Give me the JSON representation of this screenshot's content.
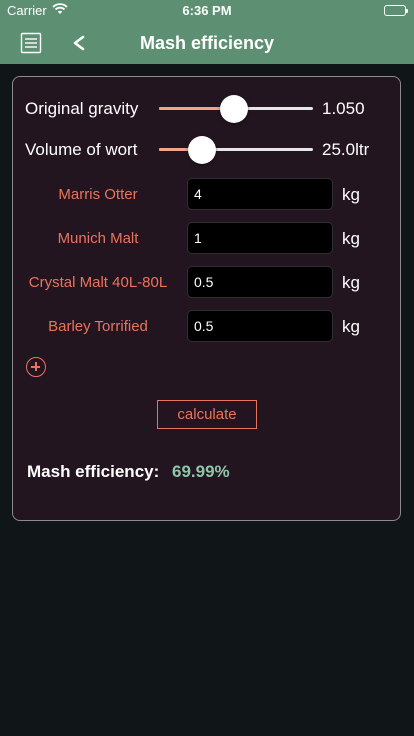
{
  "status_bar": {
    "carrier": "Carrier",
    "time": "6:36 PM",
    "icons": [
      "wifi-icon",
      "battery-icon"
    ]
  },
  "nav": {
    "title": "Mash efficiency",
    "menu_icon": "menu-icon",
    "back_icon": "chevron-left-icon"
  },
  "sliders": [
    {
      "label": "Original gravity",
      "value_text": "1.050",
      "fraction": 0.49
    },
    {
      "label": "Volume of wort",
      "value_text": "25.0ltr",
      "fraction": 0.28
    }
  ],
  "grains": [
    {
      "name": "Marris Otter",
      "amount": "4",
      "unit": "kg"
    },
    {
      "name": "Munich Malt",
      "amount": "1",
      "unit": "kg"
    },
    {
      "name": "Crystal Malt 40L-80L",
      "amount": "0.5",
      "unit": "kg"
    },
    {
      "name": "Barley Torrified",
      "amount": "0.5",
      "unit": "kg"
    }
  ],
  "add_icon": "plus-circle-icon",
  "calculate_label": "calculate",
  "result": {
    "label": "Mash efficiency:",
    "value": "69.99%"
  },
  "colors": {
    "header": "#5d8f72",
    "background": "#101617",
    "card": "#23151f",
    "accent": "#e8745c",
    "result_value": "#8ec7a8"
  }
}
